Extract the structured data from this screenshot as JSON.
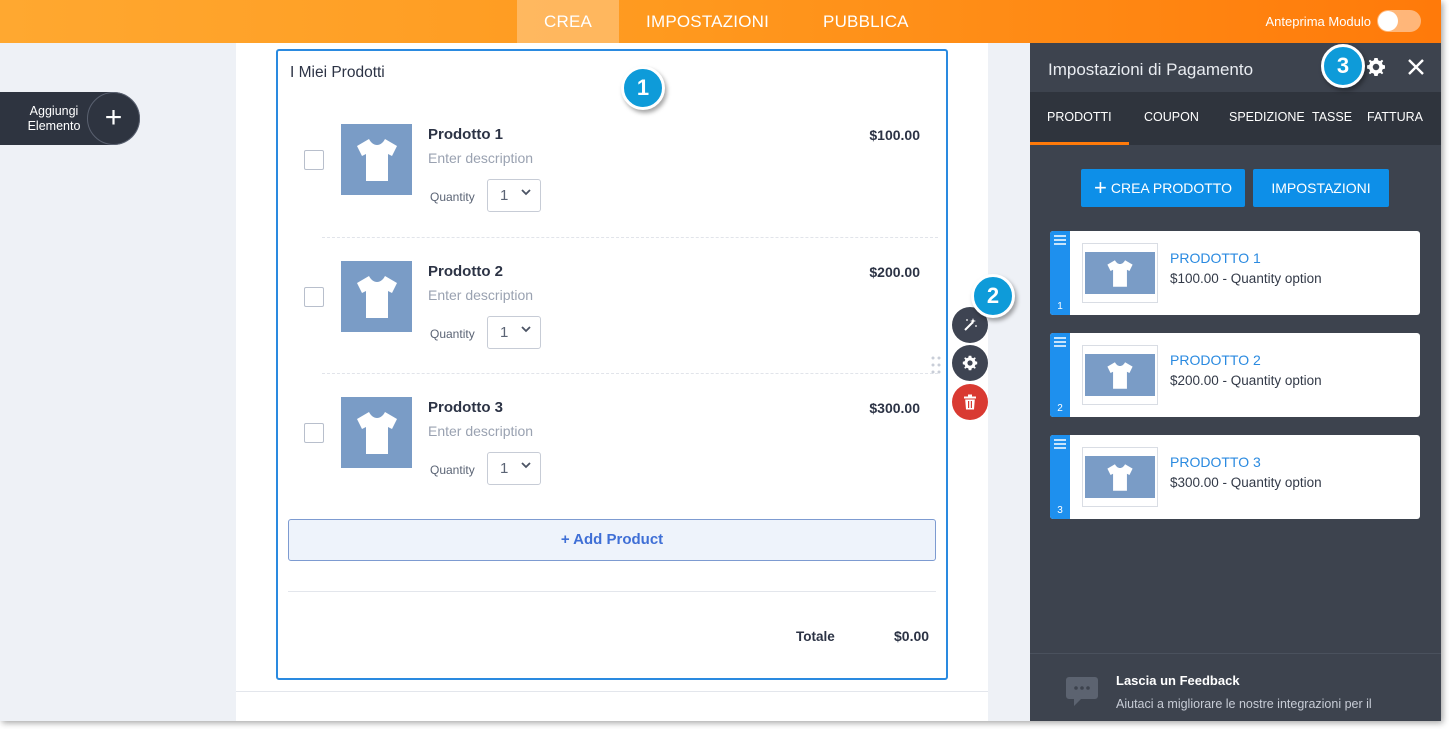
{
  "topbar": {
    "tabs": [
      {
        "label": "CREA",
        "active": true
      },
      {
        "label": "IMPOSTAZIONI",
        "active": false
      },
      {
        "label": "PUBBLICA",
        "active": false
      }
    ],
    "preview_label": "Anteprima Modulo",
    "preview_on": false
  },
  "left": {
    "add_element_line1": "Aggiungi",
    "add_element_line2": "Elemento",
    "add_symbol": "+"
  },
  "form": {
    "title": "I Miei Prodotti",
    "products": [
      {
        "name": "Prodotto 1",
        "description": "Enter description",
        "quantity_label": "Quantity",
        "quantity": "1",
        "price": "$100.00"
      },
      {
        "name": "Prodotto 2",
        "description": "Enter description",
        "quantity_label": "Quantity",
        "quantity": "1",
        "price": "$200.00"
      },
      {
        "name": "Prodotto 3",
        "description": "Enter description",
        "quantity_label": "Quantity",
        "quantity": "1",
        "price": "$300.00"
      }
    ],
    "add_product_label": "+ Add Product",
    "total_label": "Totale",
    "total_value": "$0.00"
  },
  "badges": [
    "1",
    "2",
    "3"
  ],
  "panel": {
    "title": "Impostazioni di Pagamento",
    "tabs": [
      {
        "label": "PRODOTTI",
        "active": true
      },
      {
        "label": "COUPON",
        "active": false
      },
      {
        "label": "SPEDIZIONE",
        "active": false
      },
      {
        "label": "TASSE",
        "active": false
      },
      {
        "label": "FATTURA",
        "active": false
      }
    ],
    "create_button": "CREA PRODOTTO",
    "create_symbol": "+",
    "settings_button": "IMPOSTAZIONI",
    "products": [
      {
        "index": "1",
        "name": "PRODOTTO 1",
        "detail": "$100.00 - Quantity option"
      },
      {
        "index": "2",
        "name": "PRODOTTO 2",
        "detail": "$200.00 - Quantity option"
      },
      {
        "index": "3",
        "name": "PRODOTTO 3",
        "detail": "$300.00 - Quantity option"
      }
    ],
    "feedback_title": "Lascia un Feedback",
    "feedback_text": "Aiutaci a migliorare le nostre integrazioni per il"
  },
  "colors": {
    "topbar_start": "#ffa830",
    "topbar_end": "#ff7a0a",
    "accent_blue": "#0d8fe8",
    "panel_bg": "#3d434e",
    "badge": "#0e9bd9",
    "delete_red": "#d93a32",
    "product_image": "#7a9cc6"
  },
  "icons": [
    "plus-icon",
    "tshirt-icon",
    "chevron-down-icon",
    "magic-wand-icon",
    "gear-icon",
    "trash-icon",
    "drag-handle-icon",
    "close-icon",
    "hamburger-icon",
    "chat-bubble-icon"
  ]
}
